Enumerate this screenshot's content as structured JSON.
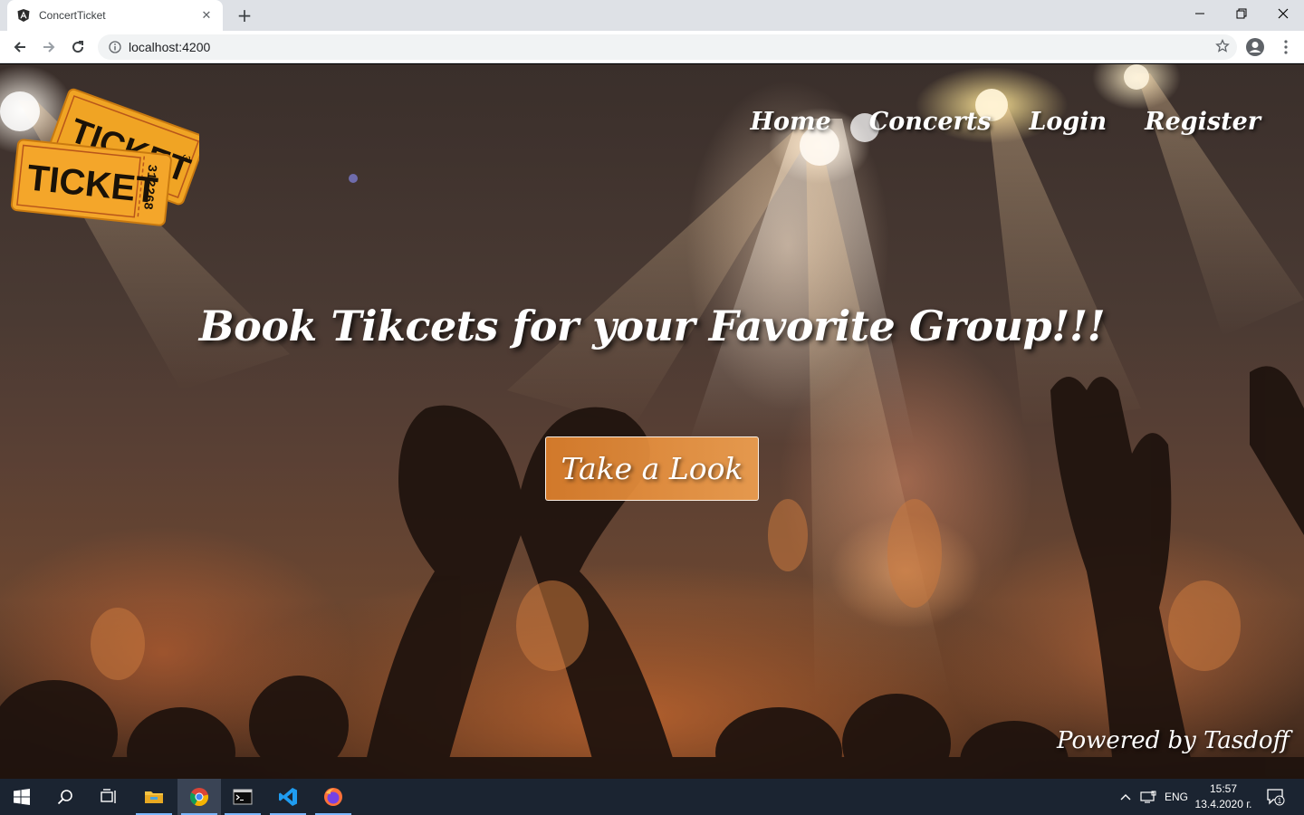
{
  "browser": {
    "tab_title": "ConcertTicket",
    "tab_close": "✕",
    "new_tab": "+",
    "url": "localhost:4200"
  },
  "site": {
    "logo": {
      "front_text": "TICKET",
      "front_number": "312268",
      "back_text": "TICKET",
      "back_number": "3"
    },
    "nav": [
      "Home",
      "Concerts",
      "Login",
      "Register"
    ],
    "hero_title": "Book Tikcets for your Favorite Group!!!",
    "cta_label": "Take a Look",
    "footer_credit": "Powered by Tasdoff",
    "accent_color": "#e8892f"
  },
  "taskbar": {
    "apps": [
      "windows-start",
      "search",
      "task-view",
      "file-explorer",
      "chrome",
      "terminal",
      "vscode",
      "firefox"
    ],
    "language": "ENG",
    "time": "15:57",
    "date": "13.4.2020 г.",
    "notification_count": "1"
  }
}
